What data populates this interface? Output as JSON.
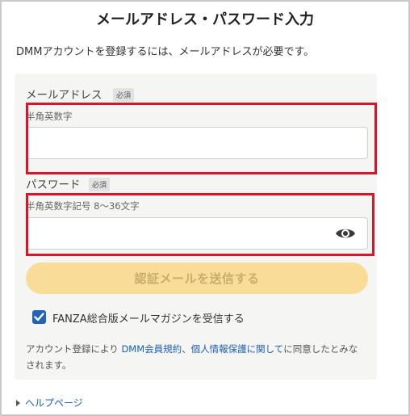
{
  "page": {
    "title": "メールアドレス・パスワード入力",
    "intro": "DMMアカウントを登録するには、メールアドレスが必要です。"
  },
  "form": {
    "email": {
      "label": "メールアドレス",
      "required_badge": "必須",
      "hint": "半角英数字",
      "value": ""
    },
    "password": {
      "label": "パスワード",
      "required_badge": "必須",
      "hint": "半角英数字記号 8〜36文字",
      "value": "",
      "toggle_icon": "eye-icon"
    },
    "submit_label": "認証メールを送信する",
    "newsletter": {
      "checked": true,
      "label": "FANZA総合版メールマガジンを受信する"
    },
    "terms": {
      "prefix": "アカウント登録により ",
      "link_terms": "DMM会員規約",
      "sep": "、",
      "link_privacy": "個人情報保護に関して",
      "suffix": "に同意したとみなされます。"
    }
  },
  "footer": {
    "help_label": "ヘルプページ"
  },
  "colors": {
    "highlight": "#d9152a",
    "button_bg": "#f8dc98",
    "checkbox": "#1f64b7",
    "link": "#1b5fb3"
  }
}
